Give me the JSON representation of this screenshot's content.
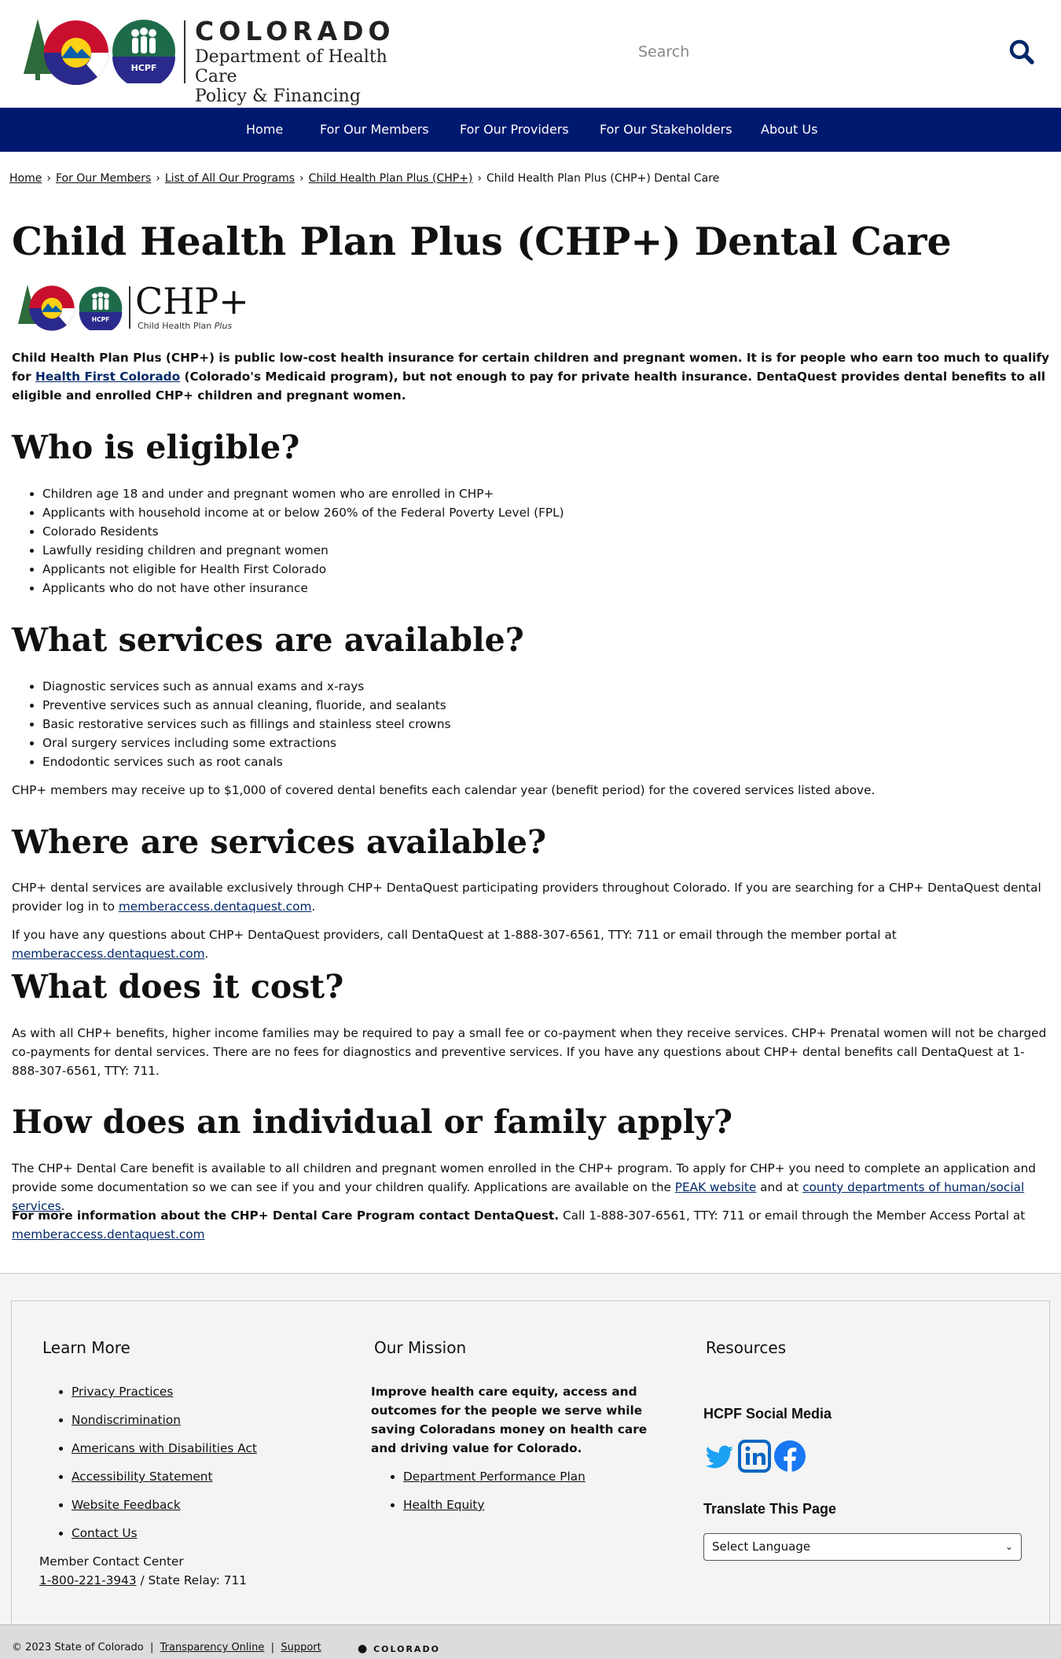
{
  "header": {
    "logo_colorado": "COLORADO",
    "logo_dept_line1": "Department of Health Care",
    "logo_dept_line2": "Policy & Financing",
    "logo_hcpf": "HCPF",
    "search_placeholder": "Search",
    "search_icon": "search-icon"
  },
  "nav": {
    "items": [
      "Home",
      "For Our Members",
      "For Our Providers",
      "For Our Stakeholders",
      "About Us"
    ]
  },
  "breadcrumb": {
    "items": [
      "Home",
      "For Our Members",
      "List of All Our Programs",
      "Child Health Plan Plus (CHP+)"
    ],
    "current": "Child Health Plan Plus (CHP+) Dental Care",
    "separator": "›"
  },
  "page": {
    "title": "Child Health Plan Plus (CHP+) Dental Care",
    "chp_logo_title": "CHP+",
    "chp_logo_sub": "Child Health Plan",
    "chp_logo_sub_italic": "Plus",
    "intro_a": "Child Health Plan Plus (CHP+) is public low-cost health insurance for certain children and pregnant women. It is for people who earn too much to qualify for ",
    "intro_link": "Health First Colorado",
    "intro_b": " (Colorado's Medicaid program), but not enough to pay for private health insurance. DentaQuest provides dental benefits to all eligible and enrolled CHP+ children and pregnant women.",
    "eligible_heading": "Who is eligible?",
    "eligible_items": [
      "Children age 18 and under and pregnant women who are enrolled in CHP+",
      "Applicants with household income at or below 260% of the Federal Poverty Level (FPL)",
      "Colorado Residents",
      "Lawfully residing children and pregnant women",
      "Applicants not eligible for Health First Colorado",
      "Applicants who do not have other insurance"
    ],
    "services_heading": "What services are available?",
    "services_items": [
      "Diagnostic services such as annual exams and x-rays",
      "Preventive services such as annual cleaning, fluoride, and sealants",
      "Basic restorative services such as fillings and stainless steel crowns",
      "Oral surgery services including some extractions",
      "Endodontic services such as root canals"
    ],
    "services_note": "CHP+ members may receive up to $1,000 of covered dental benefits each calendar year (benefit period) for the covered services listed above.",
    "where_heading": "Where are services available?",
    "where_p1_a": "CHP+ dental services are available exclusively through CHP+ DentaQuest participating providers throughout Colorado. If you are searching for a CHP+ DentaQuest dental provider log in to ",
    "where_p1_link": "memberaccess.dentaquest.com",
    "where_p1_b": ".",
    "where_p2_a": "If you have any questions about CHP+ DentaQuest providers, call DentaQuest at 1-888-307-6561, TTY: 711 or email through the member portal at ",
    "where_p2_link": "memberaccess.dentaquest.com",
    "where_p2_b": ".",
    "cost_heading": "What does it cost?",
    "cost_p": "As with all CHP+ benefits, higher income families may be required to pay a small fee or co-payment when they receive services. CHP+ Prenatal women will not be charged co-payments for dental services. There are no fees for diagnostics and preventive services. If you have any questions about CHP+ dental benefits call DentaQuest at 1-888-307-6561, TTY: 711.",
    "apply_heading": "How does an individual or family apply?",
    "apply_p1_a": "The CHP+ Dental Care benefit is available to all children and pregnant women enrolled in the CHP+ program. To apply for CHP+ you need to complete an application and provide some documentation so we can see if you and your children qualify. Applications are available on the ",
    "apply_p1_link1": "PEAK website",
    "apply_p1_mid": " and at ",
    "apply_p1_link2": "county departments of human/social services",
    "apply_p1_b": ".",
    "apply_p2_bold": "For more information about the CHP+ Dental Care Program contact DentaQuest.",
    "apply_p2_a": " Call 1-888-307-6561, TTY: 711 or email through the Member Access Portal at ",
    "apply_p2_link": "memberaccess.dentaquest.com"
  },
  "footer": {
    "learn_more_heading": "Learn More",
    "learn_more_items": [
      "Privacy Practices",
      "Nondiscrimination",
      "Americans with Disabilities Act",
      "Accessibility Statement",
      "Website Feedback",
      "Contact Us"
    ],
    "contact_label": "Member Contact Center",
    "contact_phone": "1-800-221-3943",
    "contact_relay": " / State Relay: 711",
    "mission_heading": "Our Mission",
    "mission_text": "Improve health care equity, access and outcomes for the people we serve while saving Coloradans money on health care and driving value for Colorado.",
    "mission_items": [
      "Department Performance Plan",
      "Health Equity"
    ],
    "resources_heading": "Resources",
    "social_heading": "HCPF Social Media",
    "social_icons": [
      "twitter-icon",
      "linkedin-icon",
      "facebook-icon"
    ],
    "translate_heading": "Translate This Page",
    "translate_selected": "Select Language",
    "bottom_copyright": "© 2023 State of Colorado",
    "bottom_links": [
      "Transparency Online",
      "Support"
    ],
    "bottom_logo": "COLORADO"
  },
  "colors": {
    "nav_bg": "#001970",
    "link_blue": "#002868",
    "twitter": "#1DA1F2",
    "linkedin": "#0A66C2",
    "facebook": "#1877F2",
    "hcpf_green": "#1e6b4a"
  }
}
